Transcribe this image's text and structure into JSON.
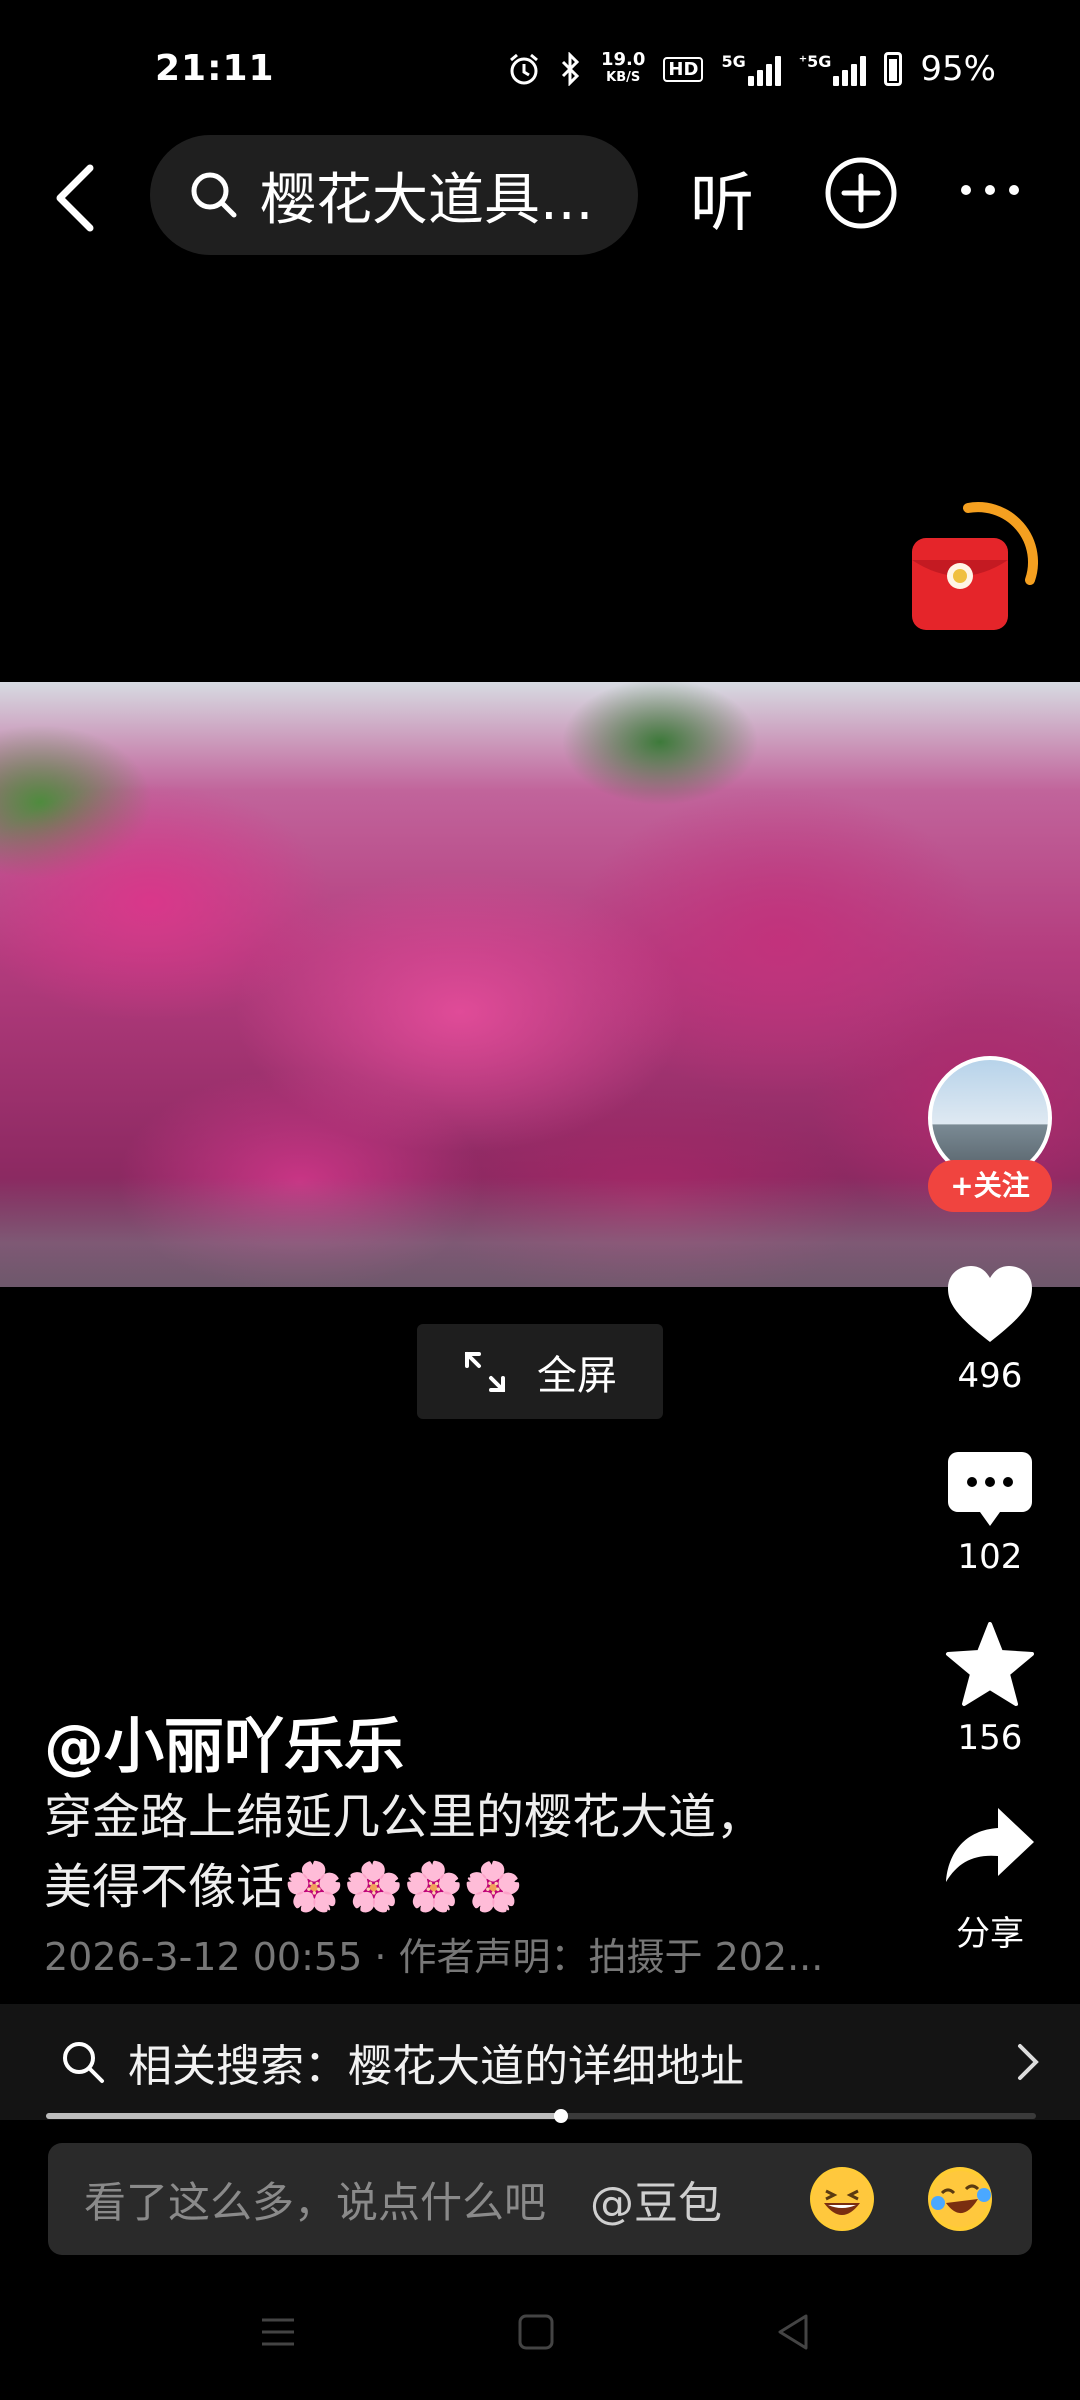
{
  "status_bar": {
    "time": "21:11",
    "net_speed_value": "19.0",
    "net_speed_unit": "KB/S",
    "hd_label": "HD",
    "sig1_label": "5G",
    "sig2_label": "⁺5G",
    "battery": "95%"
  },
  "top_nav": {
    "search_query": "樱花大道具...",
    "listen_label": "听"
  },
  "actions": {
    "follow_label": "+关注",
    "likes": "496",
    "comments": "102",
    "favorites": "156",
    "share_label": "分享"
  },
  "video": {
    "fullscreen_label": "全屏",
    "progress_fraction": 0.52
  },
  "post": {
    "author": "@小丽吖乐乐",
    "description_line1": "穿金路上绵延几公里的樱花大道，",
    "description_line2": "美得不像话🌸🌸🌸🌸",
    "meta": "2026-3-12 00:55 · 作者声明：拍摄于 202..."
  },
  "related_search": {
    "text": "相关搜索：樱花大道的详细地址"
  },
  "comment_bar": {
    "placeholder": "看了这么多，说点什么吧",
    "mention": "@豆包"
  },
  "colors": {
    "accent_red": "#f0443f",
    "background": "#000000"
  },
  "icons": [
    "back-icon",
    "search-icon",
    "add-icon",
    "more-icon",
    "red-packet-icon",
    "heart-icon",
    "comment-icon",
    "star-icon",
    "share-icon",
    "expand-icon",
    "chevron-right-icon",
    "laugh-emoji-icon",
    "cry-laugh-emoji-icon",
    "menu-icon",
    "home-icon",
    "back-triangle-icon"
  ]
}
